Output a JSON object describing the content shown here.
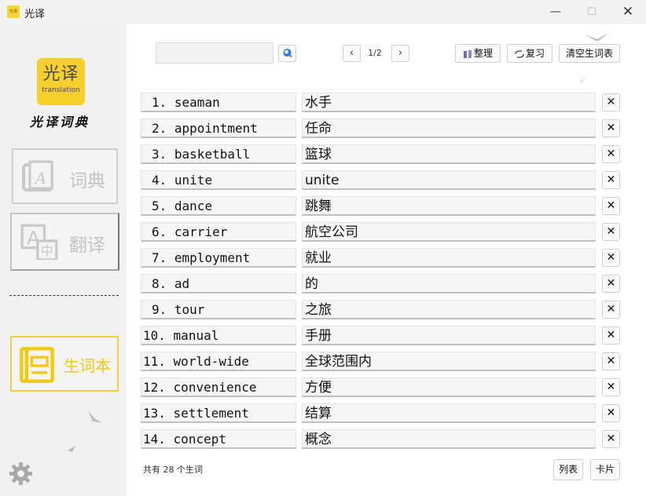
{
  "window": {
    "title": "光译",
    "minimize_glyph": "—",
    "maximize_glyph": "☐",
    "close_glyph": "✕"
  },
  "sidebar": {
    "logo_main": "光译",
    "logo_sub": "translation",
    "logo_caption": "光译词典",
    "nav": [
      {
        "label": "词典",
        "icon": "dictionary-icon",
        "active": false
      },
      {
        "label": "翻译",
        "icon": "translate-icon",
        "active": false
      },
      {
        "label": "生词本",
        "icon": "vocabulary-book-icon",
        "active": true
      }
    ],
    "accent_color": "#f5d231"
  },
  "toolbar": {
    "search_value": "",
    "page_indicator": "1/2",
    "prev_glyph": "‹",
    "next_glyph": "›",
    "sort_label": "整理",
    "review_label": "复习",
    "clear_label": "清空生词表"
  },
  "words": [
    {
      "no": "1.",
      "word": "seaman",
      "translation": "水手"
    },
    {
      "no": "2.",
      "word": "appointment",
      "translation": "任命"
    },
    {
      "no": "3.",
      "word": "basketball",
      "translation": "篮球"
    },
    {
      "no": "4.",
      "word": "unite",
      "translation": "unite"
    },
    {
      "no": "5.",
      "word": "dance",
      "translation": "跳舞"
    },
    {
      "no": "6.",
      "word": "carrier",
      "translation": "航空公司"
    },
    {
      "no": "7.",
      "word": "employment",
      "translation": "就业"
    },
    {
      "no": "8.",
      "word": "ad",
      "translation": "的"
    },
    {
      "no": "9.",
      "word": "tour",
      "translation": "之旅"
    },
    {
      "no": "10.",
      "word": "manual",
      "translation": "手册"
    },
    {
      "no": "11.",
      "word": "world-wide",
      "translation": "全球范围内"
    },
    {
      "no": "12.",
      "word": "convenience",
      "translation": "方便"
    },
    {
      "no": "13.",
      "word": "settlement",
      "translation": "结算"
    },
    {
      "no": "14.",
      "word": "concept",
      "translation": "概念"
    }
  ],
  "delete_glyph": "✕",
  "footer": {
    "total_text": "共有 28 个生词",
    "list_label": "列表",
    "card_label": "卡片"
  }
}
